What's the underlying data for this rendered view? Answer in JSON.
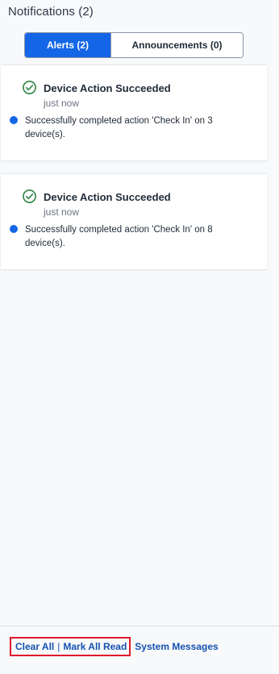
{
  "header": {
    "title": "Notifications (2)"
  },
  "tabs": [
    {
      "label": "Alerts (2)",
      "active": true
    },
    {
      "label": "Announcements (0)",
      "active": false
    }
  ],
  "notifications": [
    {
      "title": "Device Action Succeeded",
      "time": "just now",
      "message": "Successfully completed action 'Check In' on 3 device(s).",
      "status_icon": "check-circle-icon",
      "unread": true
    },
    {
      "title": "Device Action Succeeded",
      "time": "just now",
      "message": "Successfully completed action 'Check In' on 8 device(s).",
      "status_icon": "check-circle-icon",
      "unread": true
    }
  ],
  "footer": {
    "clear_all": "Clear All",
    "separator": "|",
    "mark_all_read": "Mark All Read",
    "system_messages": "System Messages"
  },
  "colors": {
    "accent": "#1466e6",
    "success": "#3a8a4e",
    "link": "#1552b0",
    "highlight": "#e0182b"
  }
}
